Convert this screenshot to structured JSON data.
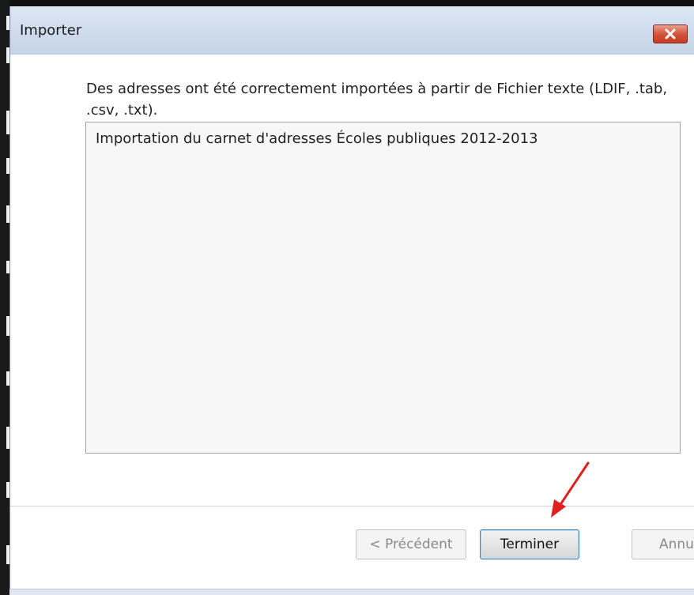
{
  "dialog": {
    "title": "Importer",
    "close_icon": "close-icon",
    "message": "Des adresses ont été correctement importées à partir de Fichier texte (LDIF, .tab, .csv, .txt).",
    "list_items": [
      "Importation du carnet d'adresses Écoles publiques 2012-2013"
    ]
  },
  "buttons": {
    "previous_label": "< Précédent",
    "finish_label": "Terminer",
    "cancel_label": "Annu"
  },
  "colors": {
    "annotation_arrow": "#e0201c",
    "close_button": "#c43b22",
    "title_bar": "#cfdced"
  }
}
